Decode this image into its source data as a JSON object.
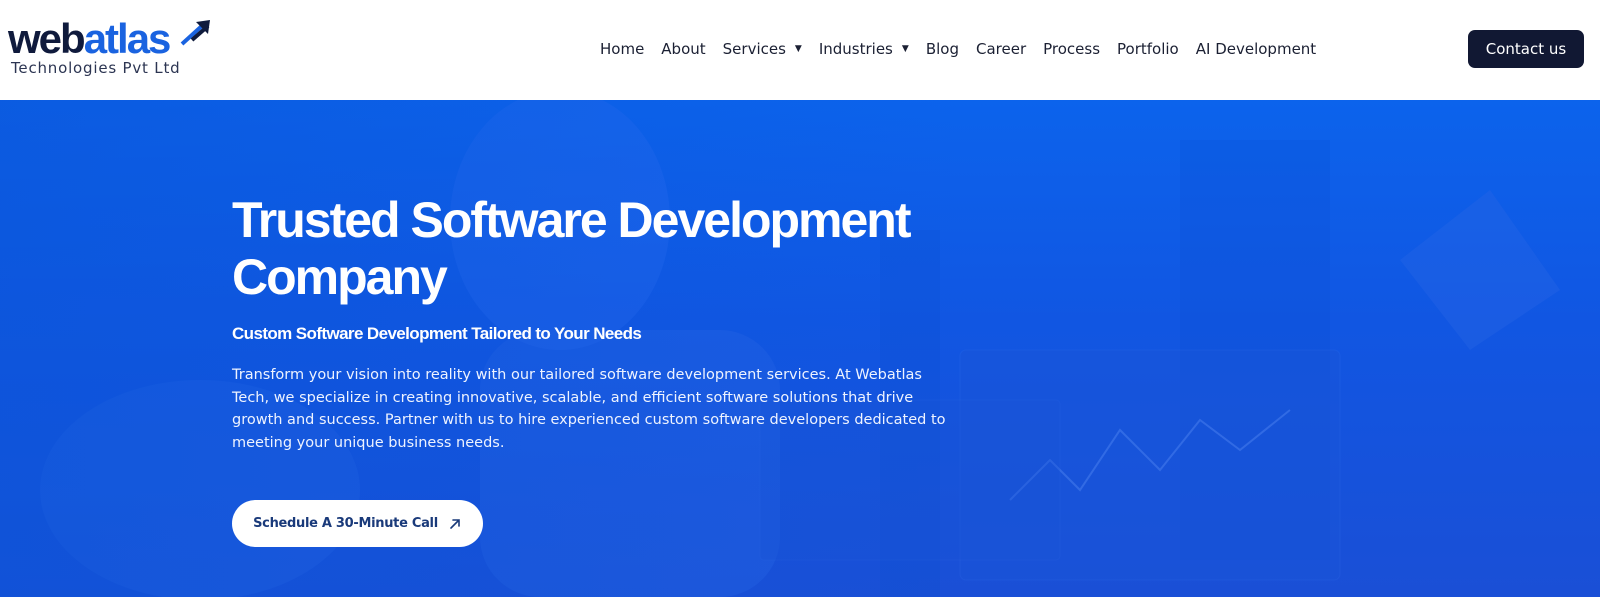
{
  "brand": {
    "logo_part1": "web",
    "logo_part2": "atlas",
    "logo_subtitle": "Technologies Pvt Ltd",
    "primary_color": "#0f1a3c",
    "accent_color": "#1a63e0"
  },
  "nav": {
    "items": [
      {
        "label": "Home",
        "has_dropdown": false
      },
      {
        "label": "About",
        "has_dropdown": false
      },
      {
        "label": "Services",
        "has_dropdown": true
      },
      {
        "label": "Industries",
        "has_dropdown": true
      },
      {
        "label": "Blog",
        "has_dropdown": false
      },
      {
        "label": "Career",
        "has_dropdown": false
      },
      {
        "label": "Process",
        "has_dropdown": false
      },
      {
        "label": "Portfolio",
        "has_dropdown": false
      },
      {
        "label": "AI Development",
        "has_dropdown": false
      }
    ],
    "dropdown_icon": "caret-down-icon",
    "contact_label": "Contact us",
    "contact_color": "#111833"
  },
  "hero": {
    "title_line1": "Trusted Software Development",
    "title_line2": "Company",
    "subtitle": "Custom Software Development Tailored to Your Needs",
    "description": "Transform your vision into reality with our tailored software development services. At Webatlas Tech, we specialize in creating innovative, scalable, and efficient software solutions that drive growth and success. Partner with us to hire experienced custom software developers dedicated to meeting your unique business needs.",
    "cta_label": "Schedule A 30-Minute Call",
    "cta_icon": "arrow-up-right-icon",
    "background_color": "#1156e2"
  }
}
